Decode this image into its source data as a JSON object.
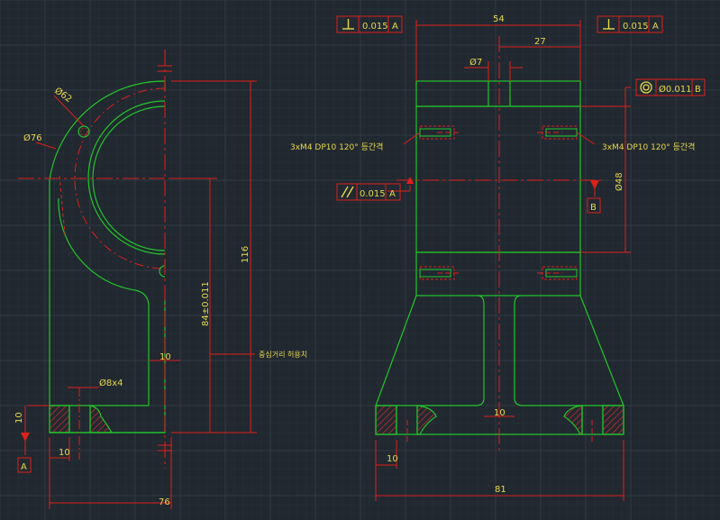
{
  "colors": {
    "background": "#212830",
    "grid": "#2c3440",
    "grid_major": "#343d4a",
    "outline": "#22c62a",
    "dimension": "#e0201a",
    "text": "#e8d84a",
    "hatch": "#c42a2a"
  },
  "icons": {
    "perpendicularity": "perpendicular-symbol-icon",
    "parallelism": "parallel-symbol-icon",
    "concentricity": "concentricity-symbol-icon",
    "datum_triangle": "datum-triangle-icon"
  },
  "dims": {
    "d54": "54",
    "d27": "27",
    "phi7": "Ø7",
    "phi48": "Ø48",
    "d81": "81",
    "d10_bottom_right": "10",
    "d10_center_right": "10",
    "d76": "76",
    "d10_bottom_left": "10",
    "d10_left_vertical": "10",
    "d10_web": "10",
    "d116": "116",
    "d84": "84±0.011",
    "phi62": "Ø62",
    "phi76": "Ø76",
    "phi8x4": "Ø8x4"
  },
  "tolerance_frames": {
    "perp_left": {
      "value": "0.015",
      "datum": "A"
    },
    "perp_right": {
      "value": "0.015",
      "datum": "A"
    },
    "parallel": {
      "value": "0.015",
      "datum": "A"
    },
    "concentric": {
      "value": "Ø0.011",
      "datum": "B"
    }
  },
  "datums": {
    "a": "A",
    "b": "B"
  },
  "notes": {
    "tap_left": "3xM4  DP10  120°  등간격",
    "tap_right": "3xM4  DP10  120°  등간격",
    "center_distance": "중심거리 허용치"
  }
}
